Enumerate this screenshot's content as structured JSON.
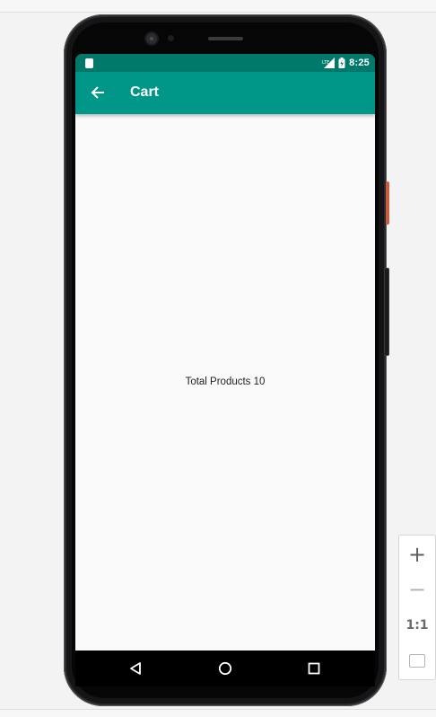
{
  "status_bar": {
    "time": "8:25",
    "icons": [
      "sd-card-icon",
      "signal-icon",
      "battery-icon"
    ]
  },
  "app_bar": {
    "title": "Cart",
    "back_icon": "arrow-back-icon"
  },
  "content": {
    "total_products_text": "Total Products 10"
  },
  "nav_bar": {
    "icons": [
      "nav-back-icon",
      "nav-home-icon",
      "nav-recents-icon"
    ]
  },
  "zoom_controls": {
    "zoom_in_label": "+",
    "zoom_out_label": "−",
    "actual_size_label": "1:1",
    "fit_icon": "fit-screen-icon"
  },
  "colors": {
    "status_bar": "#00796b",
    "app_bar": "#009688",
    "screen_background": "#fafafa",
    "power_button": "#c75f3f"
  }
}
